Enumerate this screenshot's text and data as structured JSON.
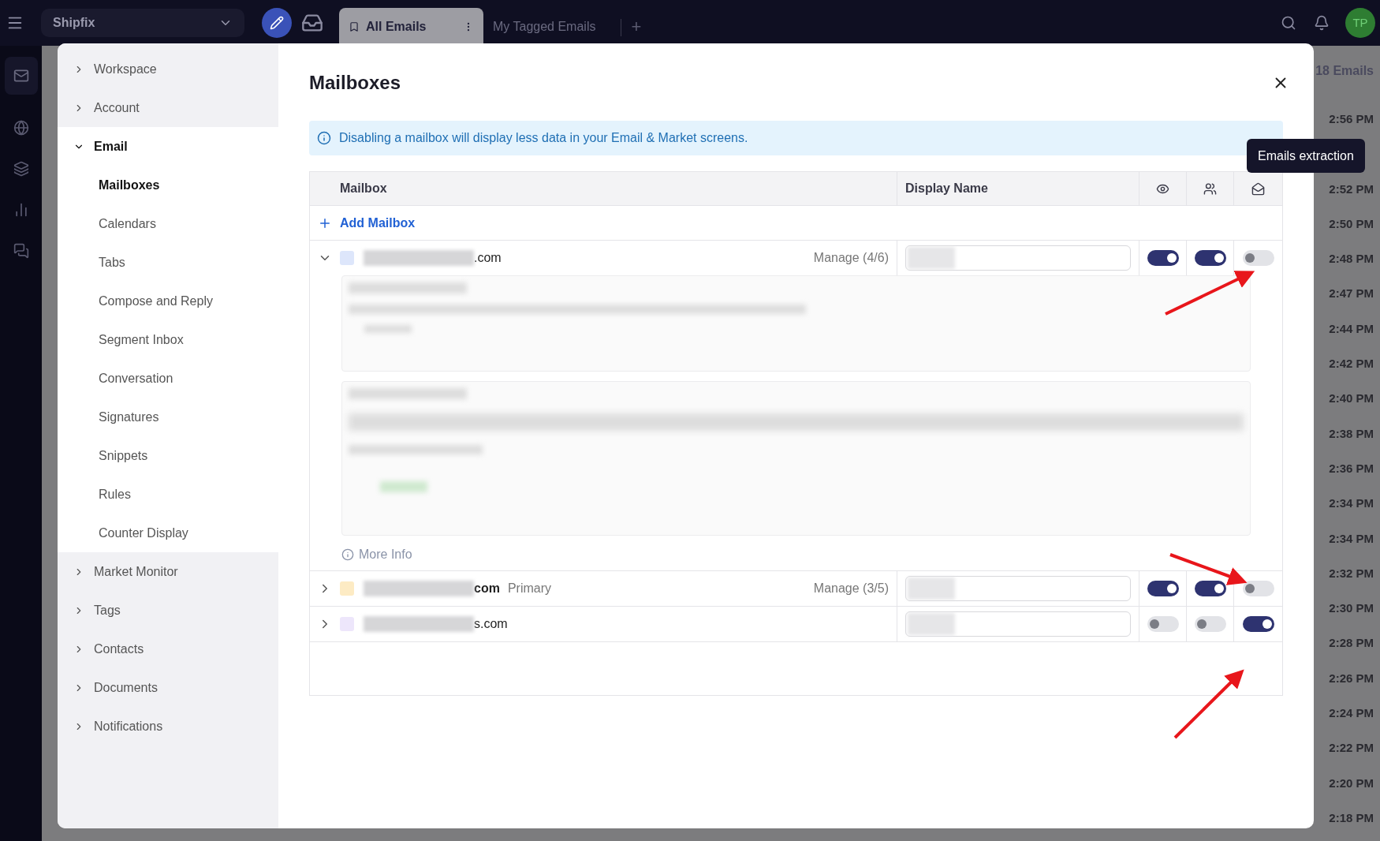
{
  "topbar": {
    "workspace": "Shipfix",
    "tabs": [
      {
        "label": "All Emails",
        "selected": true
      },
      {
        "label": "My Tagged Emails",
        "selected": false
      }
    ],
    "add_tab": "+",
    "avatar": "TP"
  },
  "background": {
    "count": "18 Emails",
    "times": [
      "2:56 PM",
      "2:52 PM",
      "2:50 PM",
      "2:48 PM",
      "2:47 PM",
      "2:44 PM",
      "2:42 PM",
      "2:40 PM",
      "2:38 PM",
      "2:36 PM",
      "2:34 PM",
      "2:34 PM",
      "2:32 PM",
      "2:30 PM",
      "2:28 PM",
      "2:26 PM",
      "2:24 PM",
      "2:22 PM",
      "2:20 PM",
      "2:18 PM"
    ]
  },
  "sidebar": {
    "items": [
      {
        "label": "Workspace",
        "expanded": false
      },
      {
        "label": "Account",
        "expanded": false
      },
      {
        "label": "Email",
        "expanded": true,
        "children": [
          {
            "label": "Mailboxes",
            "selected": true
          },
          {
            "label": "Calendars",
            "selected": false
          },
          {
            "label": "Tabs",
            "selected": false
          },
          {
            "label": "Compose and Reply",
            "selected": false
          },
          {
            "label": "Segment Inbox",
            "selected": false
          },
          {
            "label": "Conversation",
            "selected": false
          },
          {
            "label": "Signatures",
            "selected": false
          },
          {
            "label": "Snippets",
            "selected": false
          },
          {
            "label": "Rules",
            "selected": false
          },
          {
            "label": "Counter Display",
            "selected": false
          }
        ]
      },
      {
        "label": "Market Monitor",
        "expanded": false
      },
      {
        "label": "Tags",
        "expanded": false
      },
      {
        "label": "Contacts",
        "expanded": false
      },
      {
        "label": "Documents",
        "expanded": false
      },
      {
        "label": "Notifications",
        "expanded": false
      }
    ]
  },
  "dialog": {
    "title": "Mailboxes",
    "info": "Disabling a mailbox will display less data in your Email & Market screens.",
    "table": {
      "columns": [
        "Mailbox",
        "Display Name"
      ],
      "add_label": "Add Mailbox",
      "tooltip": "Emails extraction",
      "rows": [
        {
          "address": ".com",
          "color": "#dde6fb",
          "expanded": true,
          "manage": "Manage (4/6)",
          "visible": true,
          "shared": true,
          "extraction": false,
          "more_info": "More Info"
        },
        {
          "address": "com",
          "color": "#fdebc4",
          "expanded": false,
          "badge": "Primary",
          "manage": "Manage (3/5)",
          "visible": true,
          "shared": true,
          "extraction": false
        },
        {
          "address": "s.com",
          "color": "#ede6fb",
          "expanded": false,
          "visible": false,
          "shared": false,
          "extraction": true
        }
      ]
    }
  }
}
